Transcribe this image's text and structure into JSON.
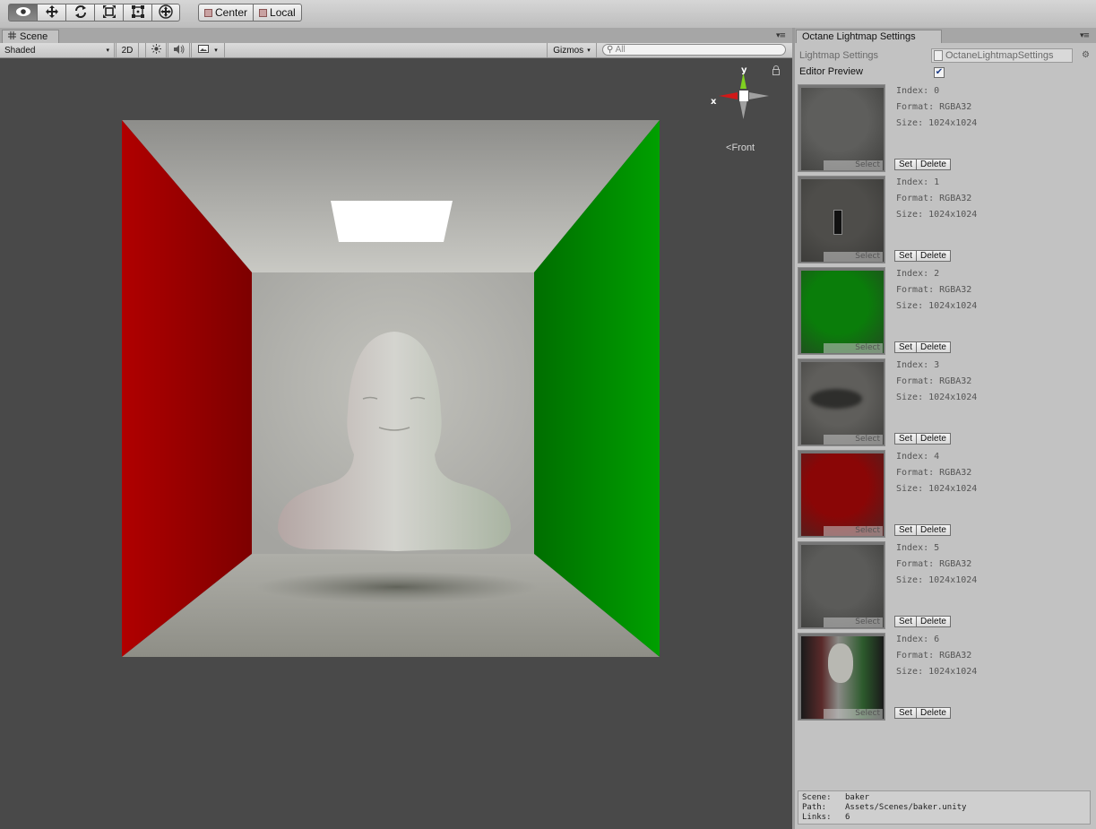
{
  "toolbar": {
    "tools": [
      "view-tool",
      "move-tool",
      "rotate-tool",
      "scale-tool",
      "rect-tool",
      "transform-tool"
    ],
    "pivot_label": "Center",
    "space_label": "Local"
  },
  "scene_tab": {
    "title": "Scene",
    "shading_mode": "Shaded",
    "mode_2d": "2D",
    "gizmos_label": "Gizmos",
    "search_placeholder": "All",
    "view_label": "Front",
    "axis_y": "y",
    "axis_x": "x"
  },
  "inspector_tab": {
    "title": "Octane Lightmap Settings",
    "settings_label": "Lightmap Settings",
    "settings_asset": "OctaneLightmapSettings",
    "editor_preview_label": "Editor Preview",
    "editor_preview_checked": true,
    "select_label": "Select",
    "set_label": "Set",
    "delete_label": "Delete"
  },
  "lightmaps": [
    {
      "index": "Index: 0",
      "format": "Format: RGBA32",
      "size": "Size: 1024x1024",
      "color": "#5e5e5c"
    },
    {
      "index": "Index: 1",
      "format": "Format: RGBA32",
      "size": "Size: 1024x1024",
      "color": "#4e4d4a"
    },
    {
      "index": "Index: 2",
      "format": "Format: RGBA32",
      "size": "Size: 1024x1024",
      "color": "#0a7d0a"
    },
    {
      "index": "Index: 3",
      "format": "Format: RGBA32",
      "size": "Size: 1024x1024",
      "color": "#5f5e5b"
    },
    {
      "index": "Index: 4",
      "format": "Format: RGBA32",
      "size": "Size: 1024x1024",
      "color": "#8a0606"
    },
    {
      "index": "Index: 5",
      "format": "Format: RGBA32",
      "size": "Size: 1024x1024",
      "color": "#5b5b59"
    },
    {
      "index": "Index: 6",
      "format": "Format: RGBA32",
      "size": "Size: 1024x1024",
      "color": "#3a3a38"
    }
  ],
  "footer": {
    "scene_key": "Scene:",
    "scene_val": "baker",
    "path_key": "Path:",
    "path_val": "Assets/Scenes/baker.unity",
    "links_key": "Links:",
    "links_val": "6"
  },
  "colors": {
    "wall_left": "#b00000",
    "wall_right": "#00a000",
    "viewport_bg": "#494949",
    "panel_bg": "#c2c2c2"
  }
}
